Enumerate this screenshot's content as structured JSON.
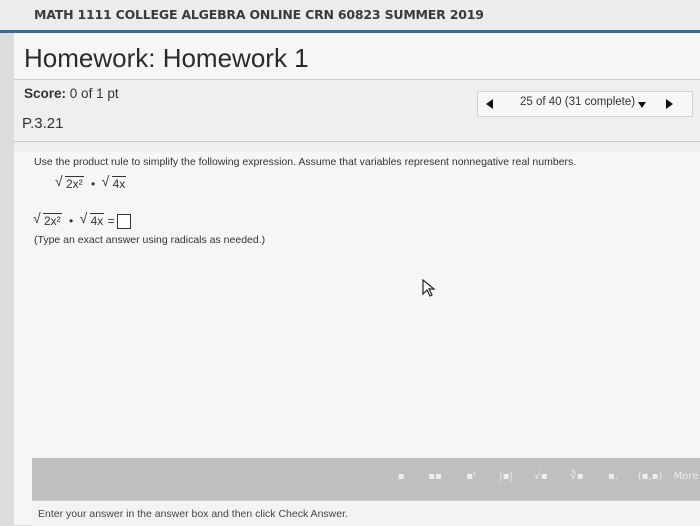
{
  "course": {
    "title": "MATH 1111 COLLEGE ALGEBRA ONLINE CRN 60823 SUMMER 2019"
  },
  "homework": {
    "title": "Homework: Homework 1"
  },
  "score": {
    "label": "Score:",
    "value": "0 of 1 pt"
  },
  "nav": {
    "status": "25 of 40 (31 complete)"
  },
  "problem": {
    "id": "P.3.21",
    "instructions": "Use the product rule to simplify the following expression. Assume that variables represent nonnegative real numbers.",
    "radicand_1": "2x²",
    "radicand_2": "4x",
    "dot": "•",
    "equals": "=",
    "hint": "(Type an exact answer using radicals as needed.)"
  },
  "toolbar": {
    "buttons": [
      "▪",
      "▪▪",
      "▪'",
      "|▪|",
      "√▪",
      "∛▪",
      "▪.",
      "(▪,▪)",
      "More"
    ]
  },
  "footer": {
    "message": "Enter your answer in the answer box and then click Check Answer."
  }
}
